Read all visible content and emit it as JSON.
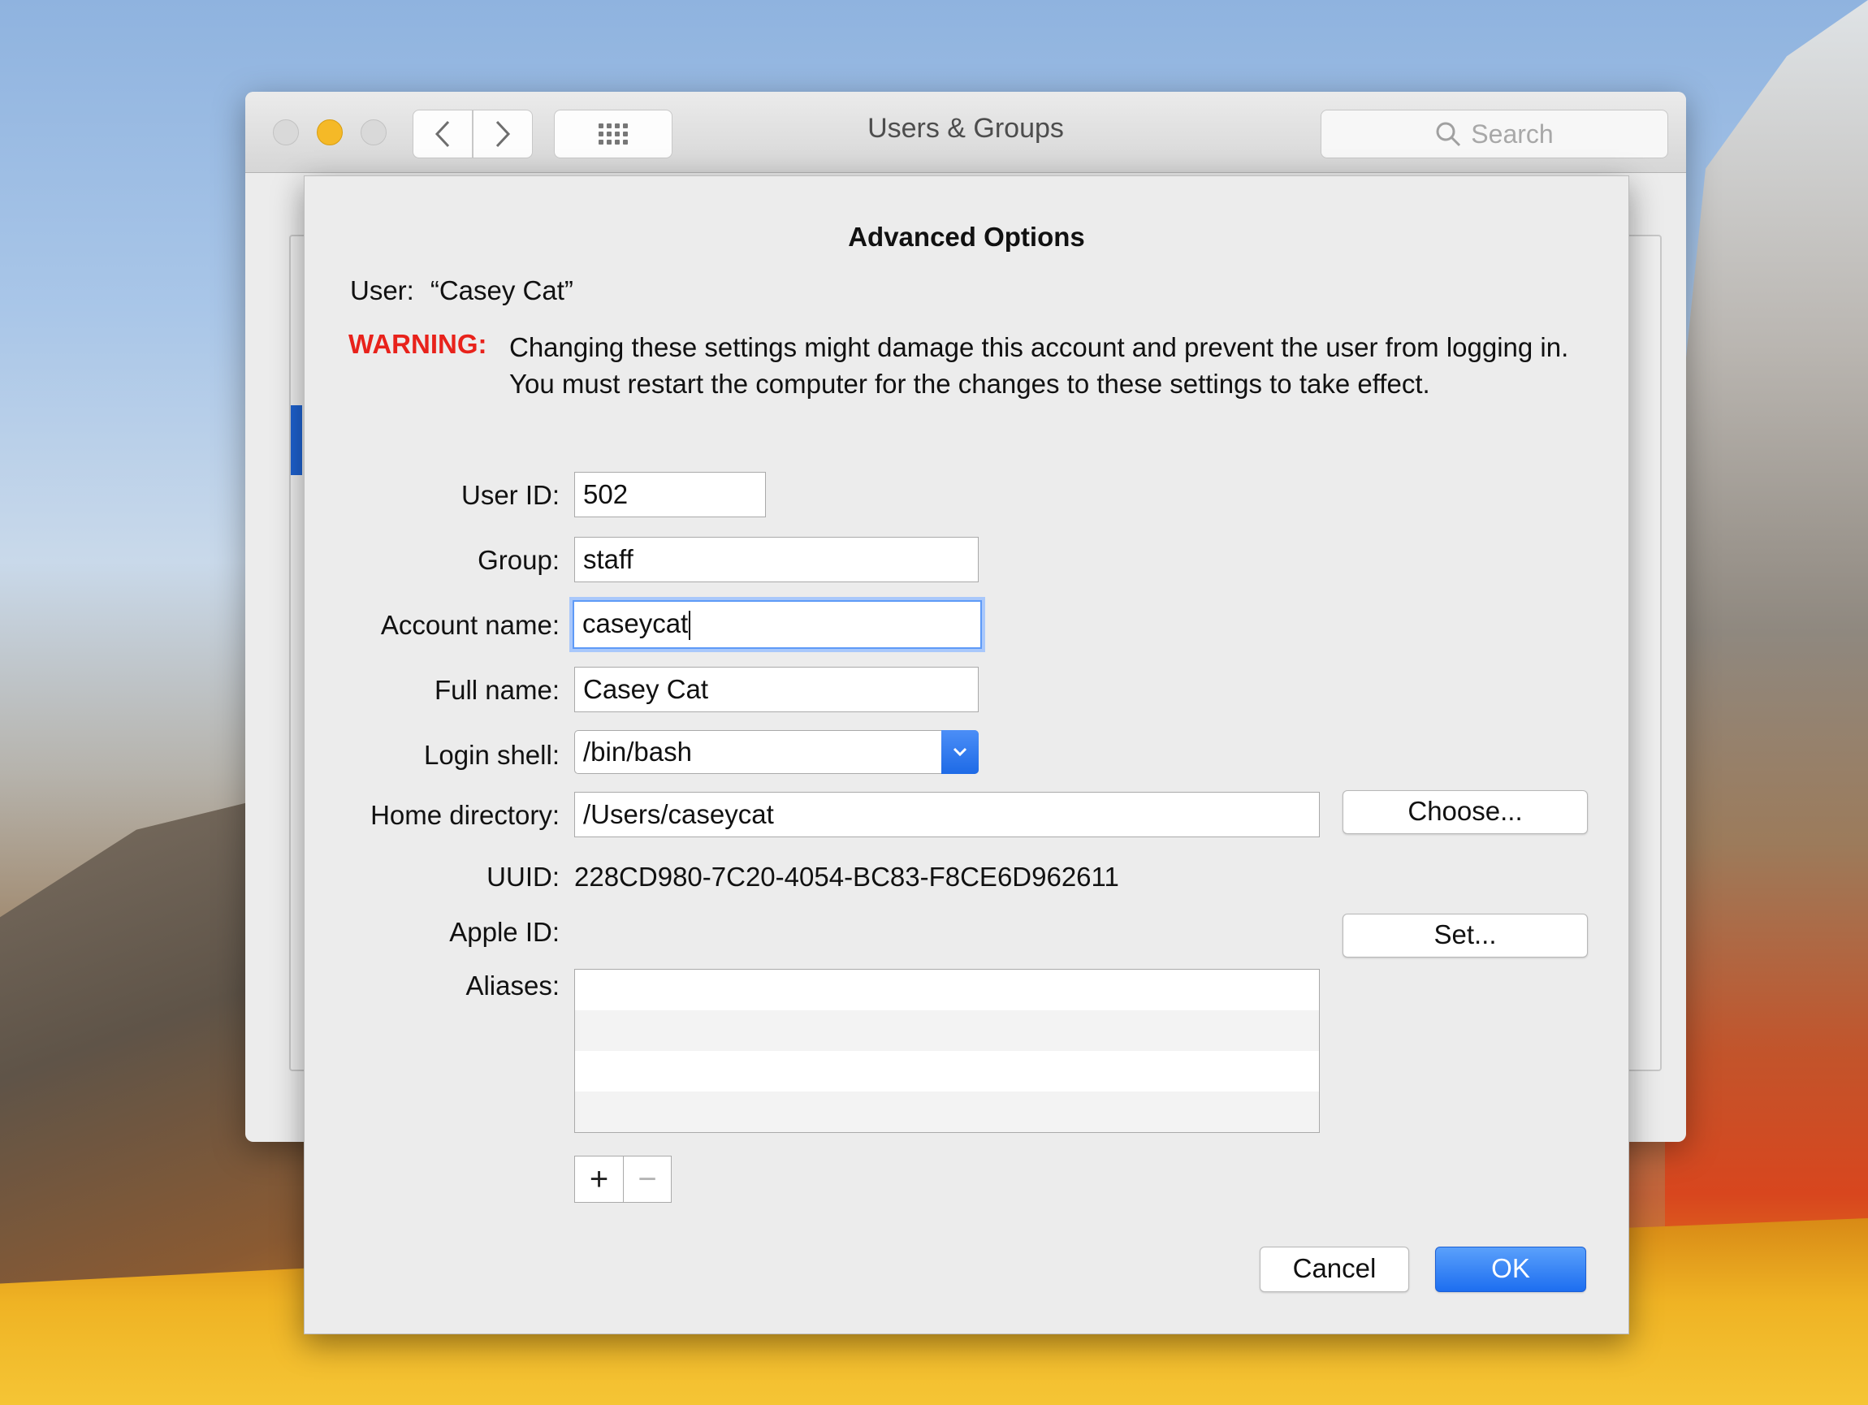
{
  "window": {
    "title": "Users & Groups",
    "search_placeholder": "Search"
  },
  "dialog": {
    "title": "Advanced Options",
    "user_label": "User:",
    "user_value": "“Casey Cat”",
    "warning_label": "WARNING:",
    "warning_text": "Changing these settings might damage this account and prevent the user from logging in. You must restart the computer for the changes to these settings to take effect.",
    "fields": {
      "user_id": {
        "label": "User ID:",
        "value": "502"
      },
      "group": {
        "label": "Group:",
        "value": "staff"
      },
      "account_name": {
        "label": "Account name:",
        "value": "caseycat"
      },
      "full_name": {
        "label": "Full name:",
        "value": "Casey Cat"
      },
      "login_shell": {
        "label": "Login shell:",
        "value": "/bin/bash"
      },
      "home_directory": {
        "label": "Home directory:",
        "value": "/Users/caseycat"
      },
      "uuid": {
        "label": "UUID:",
        "value": "228CD980-7C20-4054-BC83-F8CE6D962611"
      },
      "apple_id": {
        "label": "Apple ID:",
        "value": ""
      },
      "aliases": {
        "label": "Aliases:",
        "rows": [
          "",
          "",
          "",
          ""
        ]
      }
    },
    "buttons": {
      "choose": "Choose...",
      "set": "Set...",
      "add": "+",
      "remove": "−",
      "cancel": "Cancel",
      "ok": "OK"
    }
  },
  "colors": {
    "warning": "#e8221b",
    "accent": "#1e6ae6",
    "focus_ring": "#5e9af7",
    "minimize": "#f5b927"
  },
  "icons": {
    "back": "chevron-left-icon",
    "forward": "chevron-right-icon",
    "show_all": "grid-icon",
    "search": "magnifier-icon",
    "popup": "chevron-down-icon"
  }
}
